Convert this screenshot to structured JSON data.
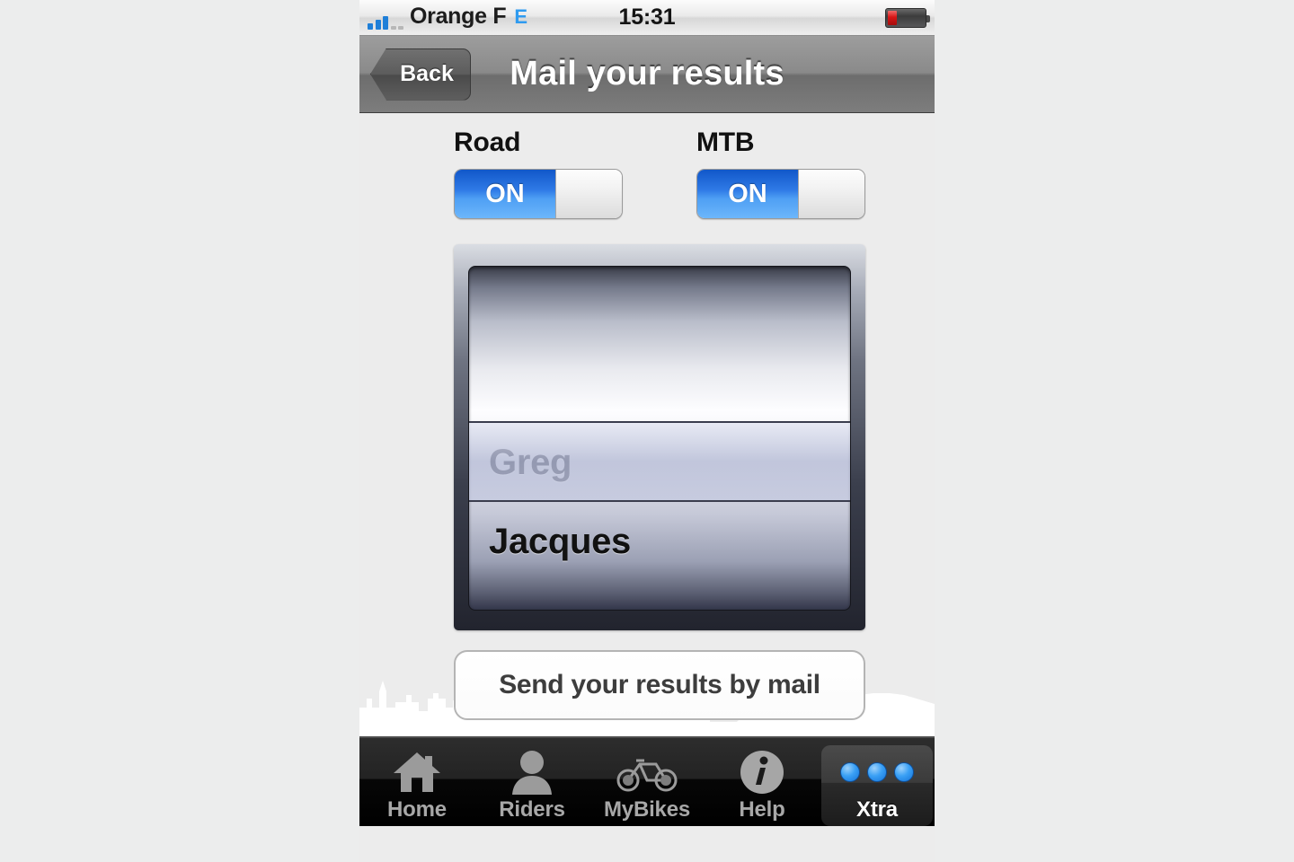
{
  "status_bar": {
    "signal_icon": "signal-bars-icon",
    "signal_bars_filled": 3,
    "signal_bars_empty": 2,
    "carrier": "Orange F",
    "network_type": "E",
    "time": "15:31",
    "battery_icon": "battery-icon",
    "battery_level_percent": 24,
    "battery_color": "#d81616"
  },
  "nav_bar": {
    "back_label": "Back",
    "title": "Mail your results"
  },
  "options": [
    {
      "label": "Road",
      "state_label": "ON",
      "enabled": true
    },
    {
      "label": "MTB",
      "state_label": "ON",
      "enabled": true
    }
  ],
  "picker": {
    "rows": [
      {
        "name": "Greg",
        "selected": true
      },
      {
        "name": "Jacques",
        "selected": false
      }
    ],
    "selected_value": "Greg"
  },
  "send_button": {
    "label": "Send your results by mail"
  },
  "tab_bar": {
    "tabs": [
      {
        "label": "Home",
        "icon": "house-icon",
        "selected": false
      },
      {
        "label": "Riders",
        "icon": "person-icon",
        "selected": false
      },
      {
        "label": "MyBikes",
        "icon": "bicycle-icon",
        "selected": false
      },
      {
        "label": "Help",
        "icon": "info-circle-icon",
        "selected": false
      },
      {
        "label": "Xtra",
        "icon": "three-dots-icon",
        "selected": true
      }
    ]
  },
  "colors": {
    "accent_blue": "#2f7ae6",
    "dot_blue": "#3aa0f5",
    "page_bg": "#ececec",
    "navbar_gray": "#8a8a8a",
    "tabbar_black": "#000000"
  }
}
